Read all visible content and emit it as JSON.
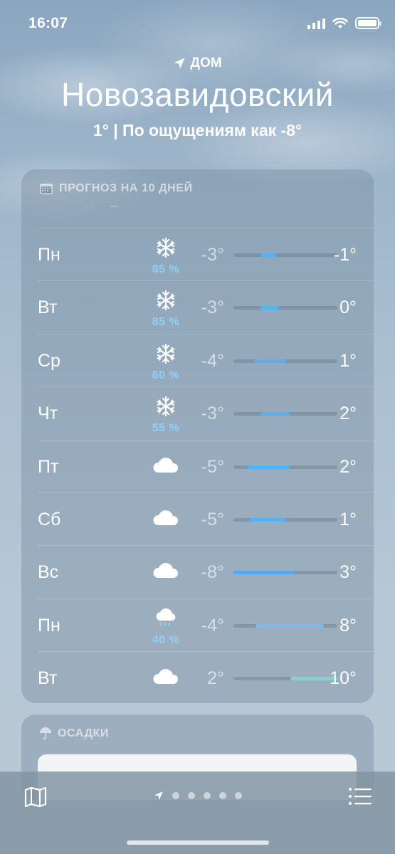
{
  "status_bar": {
    "time": "16:07"
  },
  "header": {
    "location_label": "ДОМ",
    "city": "Новозавидовский",
    "current_and_feels": "1°  |  По ощущениям как -8°"
  },
  "forecast": {
    "title": "ПРОГНОЗ НА 10 ДНЕЙ",
    "days": [
      {
        "day": "Пн",
        "icon": "snowflake-icon",
        "precip": "85 %",
        "low": "-3°",
        "high": "-1°",
        "bar_start": 0.27,
        "bar_end": 0.41,
        "bar_color": "#5ab0ef"
      },
      {
        "day": "Вт",
        "icon": "snowflake-icon",
        "precip": "85 %",
        "low": "-3°",
        "high": "0°",
        "bar_start": 0.26,
        "bar_end": 0.44,
        "bar_color": "#5ab0ef"
      },
      {
        "day": "Ср",
        "icon": "snowflake-icon",
        "precip": "60 %",
        "low": "-4°",
        "high": "1°",
        "bar_start": 0.2,
        "bar_end": 0.51,
        "bar_color": "#5ab0ef"
      },
      {
        "day": "Чт",
        "icon": "snowflake-icon",
        "precip": "55 %",
        "low": "-3°",
        "high": "2°",
        "bar_start": 0.26,
        "bar_end": 0.54,
        "bar_color": "#5ab0ef"
      },
      {
        "day": "Пт",
        "icon": "cloud-icon",
        "precip": "",
        "low": "-5°",
        "high": "2°",
        "bar_start": 0.14,
        "bar_end": 0.54,
        "bar_color": "#5ab0ef"
      },
      {
        "day": "Сб",
        "icon": "cloud-icon",
        "precip": "",
        "low": "-5°",
        "high": "1°",
        "bar_start": 0.15,
        "bar_end": 0.51,
        "bar_color": "#5ab0ef"
      },
      {
        "day": "Вс",
        "icon": "cloud-icon",
        "precip": "",
        "low": "-8°",
        "high": "3°",
        "bar_start": 0.0,
        "bar_end": 0.59,
        "bar_color": "#5aa6ef"
      },
      {
        "day": "Пн",
        "icon": "cloud-rain-icon",
        "precip": "40 %",
        "low": "-4°",
        "high": "8°",
        "bar_start": 0.21,
        "bar_end": 0.87,
        "bar_color": "#6cc2ec"
      },
      {
        "day": "Вт",
        "icon": "cloud-icon",
        "precip": "",
        "low": "2°",
        "high": "10°",
        "bar_start": 0.55,
        "bar_end": 1.0,
        "bar_color": "#7fd6d0"
      }
    ]
  },
  "precipitation": {
    "title": "ОСАДКИ"
  },
  "colors": {
    "precip_text": "#8fd0f7",
    "bar_track": "#5a6e82"
  }
}
